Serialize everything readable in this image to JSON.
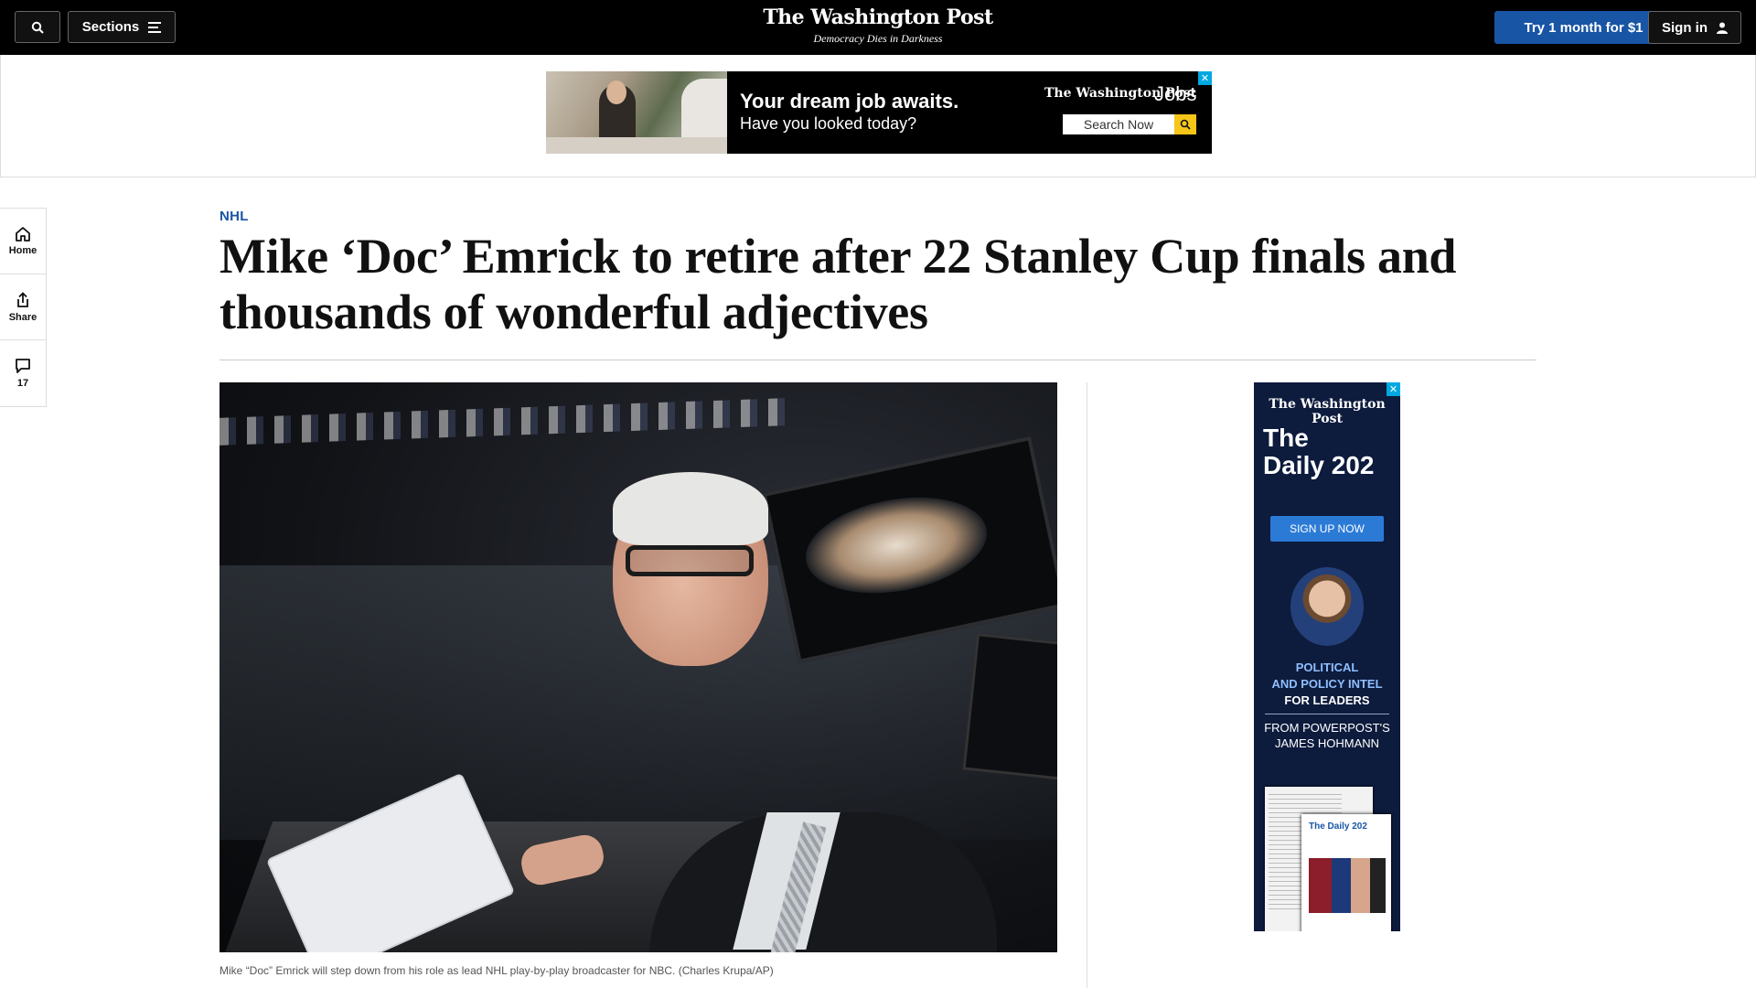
{
  "header": {
    "sections_label": "Sections",
    "logo": "The Washington Post",
    "tagline": "Democracy Dies in Darkness",
    "subscribe_label": "Try 1 month for $1",
    "signin_label": "Sign in"
  },
  "top_ad": {
    "headline": "Your dream job awaits.",
    "subtext": "Have you looked today?",
    "brand": "The Washington Post",
    "brand_suffix": "Jobs",
    "search_label": "Search Now",
    "close_label": "✕"
  },
  "rail": {
    "home_label": "Home",
    "share_label": "Share",
    "comments_count": "17"
  },
  "article": {
    "kicker": "NHL",
    "headline": "Mike ‘Doc’ Emrick to retire after 22 Stanley Cup finals and thousands of wonderful adjectives",
    "caption": "Mike “Doc” Emrick will step down from his role as lead NHL play-by-play broadcaster for NBC. (Charles Krupa/AP)"
  },
  "side_ad": {
    "brand": "The Washington Post",
    "title_line1": "The",
    "title_line2": "Daily 202",
    "cta": "SIGN UP NOW",
    "line1": "POLITICAL",
    "line2": "AND POLICY INTEL",
    "line3": "FOR LEADERS",
    "from_line1": "FROM POWERPOST'S",
    "from_line2": "JAMES HOHMANN",
    "paper_title": "The Daily 202",
    "close_label": "✕"
  },
  "colors": {
    "accent_blue": "#1955a5",
    "topbar_bg": "#000000",
    "side_ad_bg": "#0d1b3d"
  },
  "icons": [
    "search-icon",
    "hamburger-icon",
    "user-icon",
    "home-icon",
    "share-icon",
    "comment-icon",
    "magnifier-icon",
    "close-icon"
  ]
}
